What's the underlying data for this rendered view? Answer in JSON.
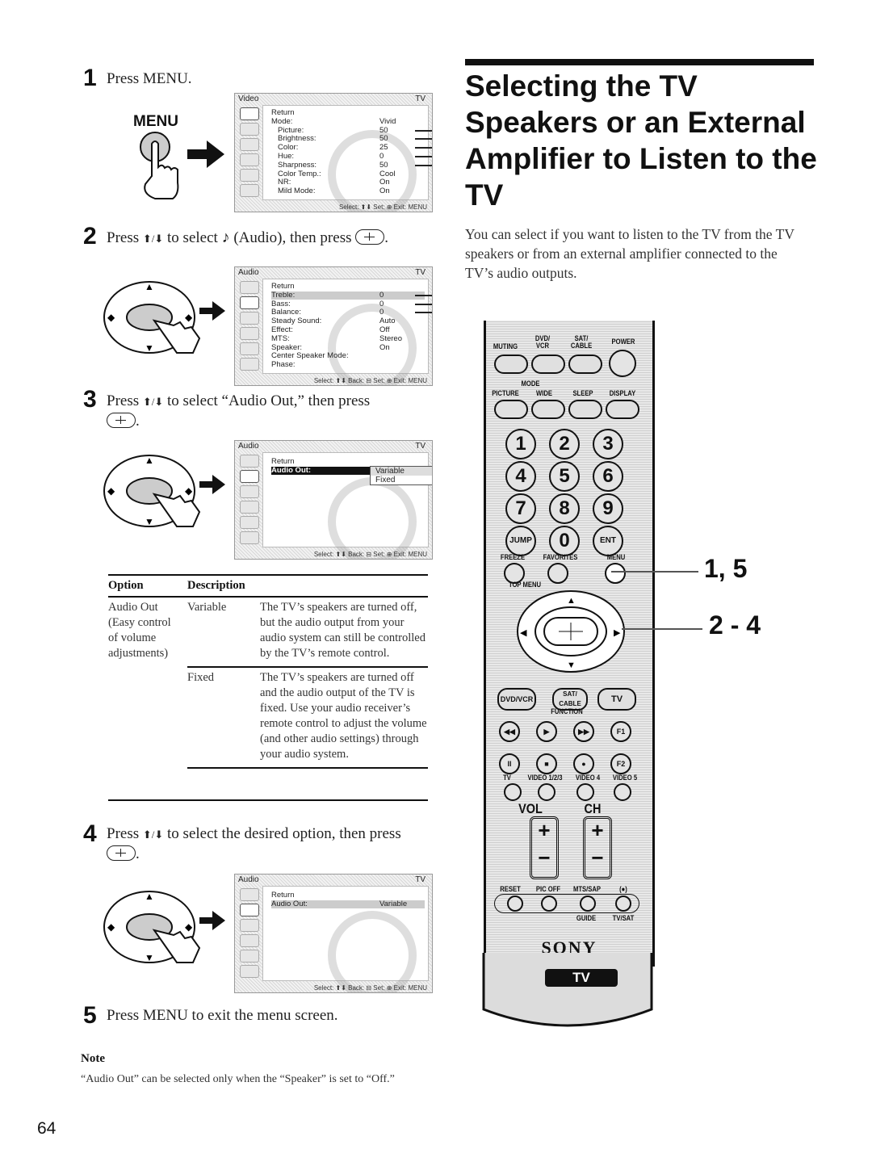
{
  "page_number": "64",
  "heading": {
    "title": "Selecting the TV Speakers or an External Amplifier to Listen to the TV",
    "intro": "You can select if you want to listen to the TV from the TV speakers or from an external amplifier connected to the TV’s audio outputs."
  },
  "steps": [
    {
      "num": "1",
      "text": "Press MENU.",
      "button_label": "MENU"
    },
    {
      "num": "2",
      "pre": "Press",
      "arrows": "⬆/⬇",
      "mid": "to select",
      "post": "(Audio), then press",
      "end": "."
    },
    {
      "num": "3",
      "pre": "Press",
      "arrows": "⬆/⬇",
      "post": "to select “Audio Out,” then press",
      "end": "."
    },
    {
      "num": "4",
      "pre": "Press",
      "arrows": "⬆/⬇",
      "post": "to select the desired option, then press",
      "end": "."
    },
    {
      "num": "5",
      "text": "Press MENU to exit the menu screen."
    }
  ],
  "osd_screens": {
    "video": {
      "title": "Video",
      "input": "TV",
      "rows": [
        {
          "label": "Return",
          "value": ""
        },
        {
          "label": "Mode:",
          "value": "Vivid"
        },
        {
          "label": "Picture:",
          "value": "50",
          "bar": 0.5
        },
        {
          "label": "Brightness:",
          "value": "50",
          "bar": 0.5
        },
        {
          "label": "Color:",
          "value": "25",
          "bar": 0.25
        },
        {
          "label": "Hue:",
          "value": "0",
          "bar": 0.5
        },
        {
          "label": "Sharpness:",
          "value": "50",
          "bar": 0.5
        },
        {
          "label": "Color Temp.:",
          "value": "Cool"
        },
        {
          "label": "NR:",
          "value": "On"
        },
        {
          "label": "Mild Mode:",
          "value": "On"
        }
      ],
      "footer": "Select: ⬆⬇  Set: ⊕  Exit: MENU"
    },
    "audio1": {
      "title": "Audio",
      "input": "TV",
      "rows": [
        {
          "label": "Return",
          "value": ""
        },
        {
          "label": "Treble:",
          "value": "0",
          "bar": 0.5
        },
        {
          "label": "Bass:",
          "value": "0",
          "bar": 0.5
        },
        {
          "label": "Balance:",
          "value": "0",
          "bar": 0.5
        },
        {
          "label": "Steady Sound:",
          "value": "Auto"
        },
        {
          "label": "Effect:",
          "value": "Off"
        },
        {
          "label": "MTS:",
          "value": "Stereo"
        },
        {
          "label": "Speaker:",
          "value": "On"
        },
        {
          "label": "Center Speaker Mode:",
          "value": ""
        },
        {
          "label": "Phase:",
          "value": ""
        }
      ],
      "footer": "Select: ⬆⬇  Back: ⊟  Set: ⊕  Exit: MENU"
    },
    "audio2": {
      "title": "Audio",
      "input": "TV",
      "rows": [
        {
          "label": "Return",
          "value": ""
        },
        {
          "label": "Audio Out:",
          "value": ""
        }
      ],
      "options": [
        "Variable",
        "Fixed"
      ],
      "footer": "Select: ⬆⬇  Back: ⊟  Set: ⊕  Exit: MENU"
    },
    "audio3": {
      "title": "Audio",
      "input": "TV",
      "rows": [
        {
          "label": "Return",
          "value": ""
        },
        {
          "label": "Audio Out:",
          "value": "Variable"
        }
      ],
      "footer": "Select: ⬆⬇  Back: ⊟  Set: ⊕  Exit: MENU"
    }
  },
  "table": {
    "headers": [
      "Option",
      "Description"
    ],
    "option_label": "Audio Out\n(Easy control\nof volume\nadjustments)",
    "rows": [
      {
        "value": "Variable",
        "description": "The TV’s speakers are turned off, but the audio output from your audio system can still be controlled by the TV’s remote control."
      },
      {
        "value": "Fixed",
        "description": "The TV’s speakers are turned off and the audio output of the TV is fixed. Use your audio receiver’s remote control to adjust the volume (and other audio settings) through your audio system."
      }
    ]
  },
  "note": {
    "title": "Note",
    "text": "“Audio Out” can be selected only when the “Speaker” is set to “Off.”"
  },
  "remote": {
    "top_labels": [
      "MUTING",
      "DVD/ VCR",
      "SAT/ CABLE",
      "POWER"
    ],
    "mode_label": "MODE",
    "mode_labels": [
      "PICTURE",
      "WIDE",
      "SLEEP",
      "DISPLAY"
    ],
    "numbers": [
      "1",
      "2",
      "3",
      "4",
      "5",
      "6",
      "7",
      "8",
      "9",
      "JUMP",
      "0",
      "ENT"
    ],
    "row_labels": [
      "FREEZE",
      "FAVORITES",
      "MENU"
    ],
    "top_menu": "TOP MENU",
    "function_buttons": [
      "DVD/VCR",
      "SAT/ CABLE",
      "TV"
    ],
    "function_label": "FUNCTION",
    "transport": [
      "◀◀",
      "▶",
      "▶▶",
      "F1",
      "II",
      "■",
      "●",
      "F2"
    ],
    "input_labels": [
      "TV",
      "VIDEO 1/2/3",
      "VIDEO 4",
      "VIDEO 5"
    ],
    "vol_label": "VOL",
    "ch_label": "CH",
    "bottom_labels": [
      "RESET",
      "PIC OFF",
      "MTS/SAP",
      "(●)"
    ],
    "bottom_sublabels": [
      "GUIDE",
      "TV/SAT"
    ],
    "brand": "SONY",
    "badge": "TV"
  },
  "callouts": [
    "1, 5",
    "2 - 4"
  ]
}
